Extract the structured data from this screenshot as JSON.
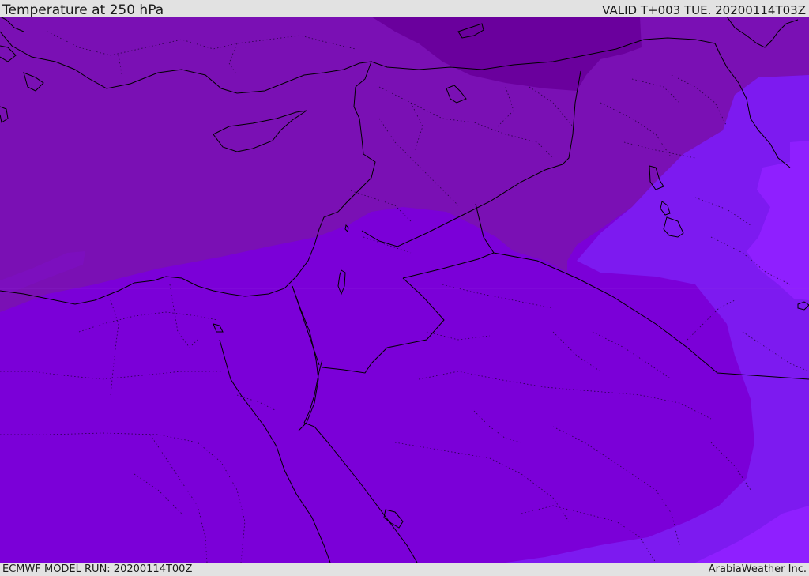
{
  "header": {
    "title": "Temperature at 250 hPa",
    "valid_time": "VALID T+003 TUE. 20200114T03Z"
  },
  "footer": {
    "model_run": "ECMWF MODEL RUN: 20200114T00Z",
    "credit": "ArabiaWeather Inc."
  },
  "map": {
    "field": "temperature",
    "level": "250 hPa",
    "colors": {
      "coldest": "#6a009d",
      "cold": "#7a10b4",
      "mid": "#7b00d8",
      "warm": "#7d1af0",
      "warmest": "#8f1fff",
      "border": "#000000"
    }
  }
}
